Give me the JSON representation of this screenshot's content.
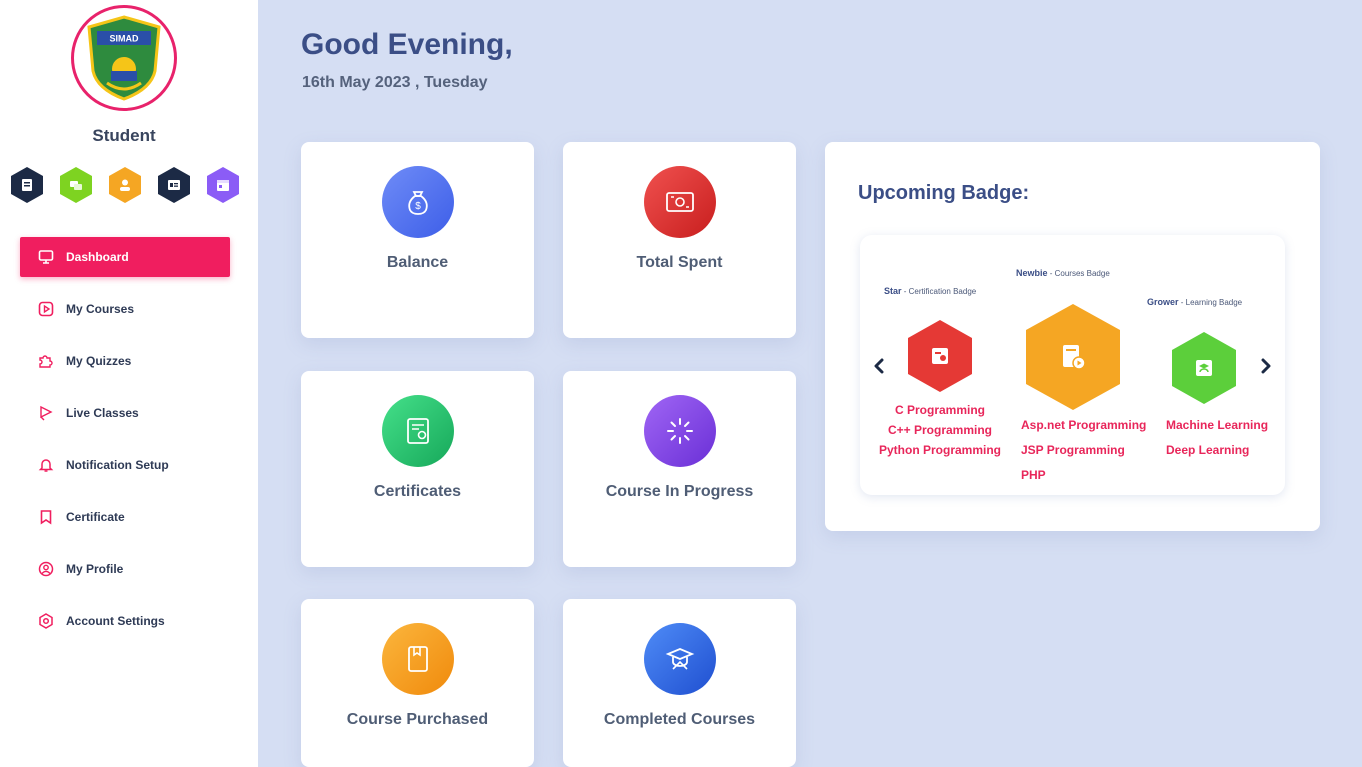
{
  "sidebar": {
    "logo_text": "SIMAD",
    "role": "Student",
    "quick_icons": [
      {
        "icon": "document-icon",
        "color": "#1c2a45"
      },
      {
        "icon": "chat-icon",
        "color": "#7ed321"
      },
      {
        "icon": "user-icon",
        "color": "#f5a623"
      },
      {
        "icon": "id-card-icon",
        "color": "#1c2a45"
      },
      {
        "icon": "calendar-icon",
        "color": "#8b5cf6"
      }
    ],
    "items": [
      {
        "label": "Dashboard",
        "icon": "monitor-icon",
        "active": true
      },
      {
        "label": "My Courses",
        "icon": "play-square-icon"
      },
      {
        "label": "My Quizzes",
        "icon": "puzzle-icon"
      },
      {
        "label": "Live Classes",
        "icon": "broadcast-icon"
      },
      {
        "label": "Notification Setup",
        "icon": "bell-icon"
      },
      {
        "label": "Certificate",
        "icon": "bookmark-icon"
      },
      {
        "label": "My Profile",
        "icon": "user-circle-icon"
      },
      {
        "label": "Account Settings",
        "icon": "gear-icon"
      }
    ],
    "accent": "#f01e5f"
  },
  "header": {
    "greeting": "Good Evening,",
    "date": "16th May 2023 , Tuesday"
  },
  "cards": [
    {
      "label": "Balance",
      "icon": "money-bag-icon",
      "color": "#4f6ff0"
    },
    {
      "label": "Total Spent",
      "icon": "banknote-icon",
      "color": "#e53935"
    },
    {
      "label": "Certificates",
      "icon": "certificate-icon",
      "color": "#22c55e"
    },
    {
      "label": "Course In Progress",
      "icon": "spinner-icon",
      "color": "#7c3aed"
    },
    {
      "label": "Course Purchased",
      "icon": "book-icon",
      "color": "#f59e0b"
    },
    {
      "label": "Completed Courses",
      "icon": "graduation-icon",
      "color": "#2563eb"
    }
  ],
  "badges": {
    "title": "Upcoming Badge:",
    "items": [
      {
        "name": "Star",
        "type": " - Certification Badge",
        "color": "#e53935",
        "icon": "certificate-badge-icon",
        "courses": [
          "C Programming",
          "C++ Programming",
          "Python Programming"
        ]
      },
      {
        "name": "Newbie",
        "type": " - Courses Badge",
        "color": "#f5a623",
        "icon": "course-badge-icon",
        "courses": [
          "Asp.net Programming",
          "JSP Programming",
          "PHP"
        ]
      },
      {
        "name": "Grower",
        "type": " - Learning Badge",
        "color": "#5ccf3b",
        "icon": "learning-badge-icon",
        "courses": [
          "Machine Learning",
          "Deep Learning"
        ]
      }
    ]
  }
}
